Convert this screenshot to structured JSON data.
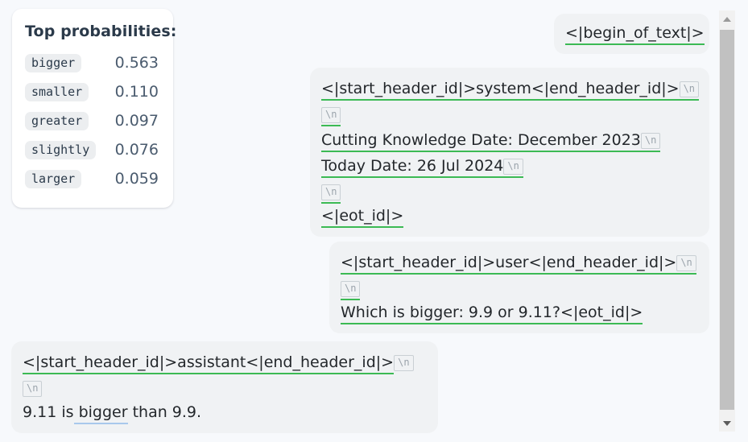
{
  "theme": {
    "page_background": "#f7f9fc",
    "bubble_background": "#f0f2f4",
    "card_background": "#ffffff",
    "token_underline_green": "#3cba54",
    "selected_token_underline_blue": "#a8c8ec",
    "chip_background": "#eceef0",
    "text_color": "#23272b",
    "title_color": "#2b3a4a",
    "value_color": "#4a5b6e",
    "newline_chip_color": "#9aa3ab",
    "scrollbar_track": "#f1f1f1",
    "scrollbar_thumb": "#c1c1c1"
  },
  "probabilities_card": {
    "title": "Top probabilities:",
    "rows": [
      {
        "token": "bigger",
        "value": "0.563"
      },
      {
        "token": "smaller",
        "value": "0.110"
      },
      {
        "token": "greater",
        "value": "0.097"
      },
      {
        "token": "slightly",
        "value": "0.076"
      },
      {
        "token": "larger",
        "value": "0.059"
      }
    ]
  },
  "messages": {
    "begin_of_text": {
      "name": "begin-of-text-bubble",
      "lines": [
        {
          "tokens": [
            {
              "text": "<|begin_of_text|>",
              "underline": "green"
            }
          ]
        }
      ]
    },
    "system": {
      "name": "system-message-bubble",
      "lines": [
        {
          "tokens": [
            {
              "text": "<|start_header_id|>system<|end_header_id|>",
              "underline": "green"
            },
            {
              "text": "\\n",
              "kind": "newline",
              "underline": "green"
            }
          ]
        },
        {
          "tokens": [
            {
              "text": "\\n",
              "kind": "newline",
              "underline": "green"
            }
          ]
        },
        {
          "tokens": [
            {
              "text": "Cutting Knowledge Date: December 2023",
              "underline": "green"
            },
            {
              "text": "\\n",
              "kind": "newline",
              "underline": "green"
            }
          ]
        },
        {
          "tokens": [
            {
              "text": "Today Date: 26 Jul 2024",
              "underline": "green"
            },
            {
              "text": "\\n",
              "kind": "newline",
              "underline": "green"
            }
          ]
        },
        {
          "tokens": [
            {
              "text": "\\n",
              "kind": "newline",
              "underline": "green"
            }
          ]
        },
        {
          "tokens": [
            {
              "text": "<|eot_id|>",
              "underline": "green"
            }
          ]
        }
      ]
    },
    "user": {
      "name": "user-message-bubble",
      "lines": [
        {
          "tokens": [
            {
              "text": "<|start_header_id|>user<|end_header_id|>",
              "underline": "green"
            },
            {
              "text": "\\n",
              "kind": "newline",
              "underline": "green"
            }
          ]
        },
        {
          "tokens": [
            {
              "text": "\\n",
              "kind": "newline",
              "underline": "green"
            }
          ]
        },
        {
          "tokens": [
            {
              "text": "Which is bigger: 9.9 or 9.11?<|eot_id|>",
              "underline": "green"
            }
          ]
        }
      ]
    },
    "assistant": {
      "name": "assistant-message-bubble",
      "lines": [
        {
          "tokens": [
            {
              "text": "<|start_header_id|>assistant<|end_header_id|>",
              "underline": "green"
            },
            {
              "text": "\\n",
              "kind": "newline",
              "underline": "none"
            }
          ]
        },
        {
          "tokens": [
            {
              "text": "\\n",
              "kind": "newline",
              "underline": "none"
            }
          ]
        },
        {
          "tokens": [
            {
              "text": "9.11 is",
              "underline": "none"
            },
            {
              "text": " bigger",
              "underline": "blue"
            },
            {
              "text": " than 9.9.",
              "underline": "none"
            }
          ]
        }
      ]
    }
  },
  "scrollbar": {
    "up_arrow_icon": "triangle-up-icon",
    "down_arrow_icon": "triangle-down-icon",
    "thumb_label": "scrollbar-thumb"
  }
}
